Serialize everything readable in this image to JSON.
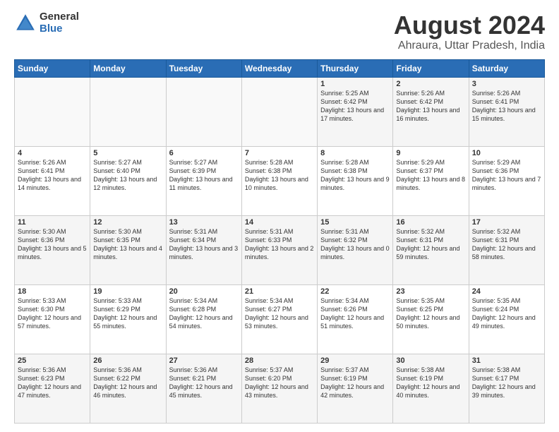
{
  "logo": {
    "general": "General",
    "blue": "Blue"
  },
  "title": "August 2024",
  "subtitle": "Ahraura, Uttar Pradesh, India",
  "days_of_week": [
    "Sunday",
    "Monday",
    "Tuesday",
    "Wednesday",
    "Thursday",
    "Friday",
    "Saturday"
  ],
  "weeks": [
    [
      {
        "day": "",
        "content": ""
      },
      {
        "day": "",
        "content": ""
      },
      {
        "day": "",
        "content": ""
      },
      {
        "day": "",
        "content": ""
      },
      {
        "day": "1",
        "content": "Sunrise: 5:25 AM\nSunset: 6:42 PM\nDaylight: 13 hours\nand 17 minutes."
      },
      {
        "day": "2",
        "content": "Sunrise: 5:26 AM\nSunset: 6:42 PM\nDaylight: 13 hours\nand 16 minutes."
      },
      {
        "day": "3",
        "content": "Sunrise: 5:26 AM\nSunset: 6:41 PM\nDaylight: 13 hours\nand 15 minutes."
      }
    ],
    [
      {
        "day": "4",
        "content": "Sunrise: 5:26 AM\nSunset: 6:41 PM\nDaylight: 13 hours\nand 14 minutes."
      },
      {
        "day": "5",
        "content": "Sunrise: 5:27 AM\nSunset: 6:40 PM\nDaylight: 13 hours\nand 12 minutes."
      },
      {
        "day": "6",
        "content": "Sunrise: 5:27 AM\nSunset: 6:39 PM\nDaylight: 13 hours\nand 11 minutes."
      },
      {
        "day": "7",
        "content": "Sunrise: 5:28 AM\nSunset: 6:38 PM\nDaylight: 13 hours\nand 10 minutes."
      },
      {
        "day": "8",
        "content": "Sunrise: 5:28 AM\nSunset: 6:38 PM\nDaylight: 13 hours\nand 9 minutes."
      },
      {
        "day": "9",
        "content": "Sunrise: 5:29 AM\nSunset: 6:37 PM\nDaylight: 13 hours\nand 8 minutes."
      },
      {
        "day": "10",
        "content": "Sunrise: 5:29 AM\nSunset: 6:36 PM\nDaylight: 13 hours\nand 7 minutes."
      }
    ],
    [
      {
        "day": "11",
        "content": "Sunrise: 5:30 AM\nSunset: 6:36 PM\nDaylight: 13 hours\nand 5 minutes."
      },
      {
        "day": "12",
        "content": "Sunrise: 5:30 AM\nSunset: 6:35 PM\nDaylight: 13 hours\nand 4 minutes."
      },
      {
        "day": "13",
        "content": "Sunrise: 5:31 AM\nSunset: 6:34 PM\nDaylight: 13 hours\nand 3 minutes."
      },
      {
        "day": "14",
        "content": "Sunrise: 5:31 AM\nSunset: 6:33 PM\nDaylight: 13 hours\nand 2 minutes."
      },
      {
        "day": "15",
        "content": "Sunrise: 5:31 AM\nSunset: 6:32 PM\nDaylight: 13 hours\nand 0 minutes."
      },
      {
        "day": "16",
        "content": "Sunrise: 5:32 AM\nSunset: 6:31 PM\nDaylight: 12 hours\nand 59 minutes."
      },
      {
        "day": "17",
        "content": "Sunrise: 5:32 AM\nSunset: 6:31 PM\nDaylight: 12 hours\nand 58 minutes."
      }
    ],
    [
      {
        "day": "18",
        "content": "Sunrise: 5:33 AM\nSunset: 6:30 PM\nDaylight: 12 hours\nand 57 minutes."
      },
      {
        "day": "19",
        "content": "Sunrise: 5:33 AM\nSunset: 6:29 PM\nDaylight: 12 hours\nand 55 minutes."
      },
      {
        "day": "20",
        "content": "Sunrise: 5:34 AM\nSunset: 6:28 PM\nDaylight: 12 hours\nand 54 minutes."
      },
      {
        "day": "21",
        "content": "Sunrise: 5:34 AM\nSunset: 6:27 PM\nDaylight: 12 hours\nand 53 minutes."
      },
      {
        "day": "22",
        "content": "Sunrise: 5:34 AM\nSunset: 6:26 PM\nDaylight: 12 hours\nand 51 minutes."
      },
      {
        "day": "23",
        "content": "Sunrise: 5:35 AM\nSunset: 6:25 PM\nDaylight: 12 hours\nand 50 minutes."
      },
      {
        "day": "24",
        "content": "Sunrise: 5:35 AM\nSunset: 6:24 PM\nDaylight: 12 hours\nand 49 minutes."
      }
    ],
    [
      {
        "day": "25",
        "content": "Sunrise: 5:36 AM\nSunset: 6:23 PM\nDaylight: 12 hours\nand 47 minutes."
      },
      {
        "day": "26",
        "content": "Sunrise: 5:36 AM\nSunset: 6:22 PM\nDaylight: 12 hours\nand 46 minutes."
      },
      {
        "day": "27",
        "content": "Sunrise: 5:36 AM\nSunset: 6:21 PM\nDaylight: 12 hours\nand 45 minutes."
      },
      {
        "day": "28",
        "content": "Sunrise: 5:37 AM\nSunset: 6:20 PM\nDaylight: 12 hours\nand 43 minutes."
      },
      {
        "day": "29",
        "content": "Sunrise: 5:37 AM\nSunset: 6:19 PM\nDaylight: 12 hours\nand 42 minutes."
      },
      {
        "day": "30",
        "content": "Sunrise: 5:38 AM\nSunset: 6:19 PM\nDaylight: 12 hours\nand 40 minutes."
      },
      {
        "day": "31",
        "content": "Sunrise: 5:38 AM\nSunset: 6:17 PM\nDaylight: 12 hours\nand 39 minutes."
      }
    ]
  ]
}
